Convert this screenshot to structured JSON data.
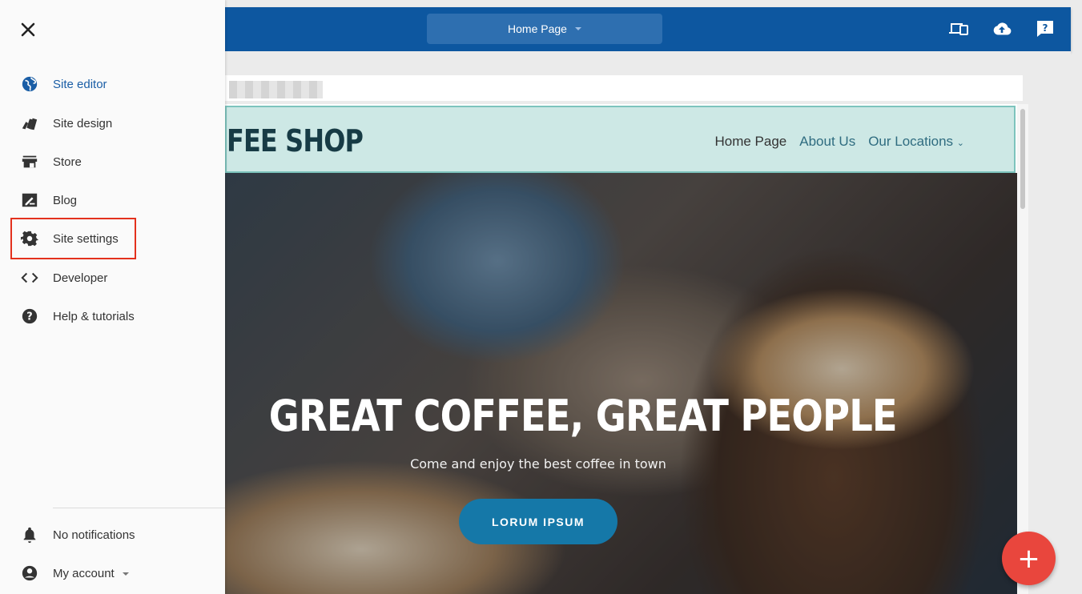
{
  "topbar": {
    "page_selector_label": "Home Page",
    "icons": [
      "device-preview-icon",
      "publish-cloud-icon",
      "help-icon"
    ]
  },
  "site": {
    "logo_text": "FEE SHOP",
    "nav": [
      "Home Page",
      "About Us",
      "Our Locations"
    ],
    "hero_title": "GREAT COFFEE, GREAT PEOPLE",
    "hero_subtitle": "Come and enjoy the best coffee in town",
    "hero_button": "LORUM IPSUM"
  },
  "sidebar": {
    "items": [
      {
        "label": "Site editor",
        "icon": "globe-icon",
        "active": true
      },
      {
        "label": "Site design",
        "icon": "palette-swatch-icon"
      },
      {
        "label": "Store",
        "icon": "store-icon"
      },
      {
        "label": "Blog",
        "icon": "blog-icon"
      },
      {
        "label": "Site settings",
        "icon": "gear-icon",
        "highlighted": true
      },
      {
        "label": "Developer",
        "icon": "code-icon"
      },
      {
        "label": "Help & tutorials",
        "icon": "help-circle-icon"
      }
    ],
    "footer": [
      {
        "label": "No notifications",
        "icon": "bell-icon"
      },
      {
        "label": "My account",
        "icon": "account-circle-icon"
      }
    ]
  },
  "fab": {
    "symbol": "+"
  },
  "colors": {
    "topbar": "#0d57a0",
    "active_text": "#1a5ea6",
    "highlight_border": "#e3311d",
    "fab": "#e9463d",
    "hero_button": "#1578a8"
  }
}
